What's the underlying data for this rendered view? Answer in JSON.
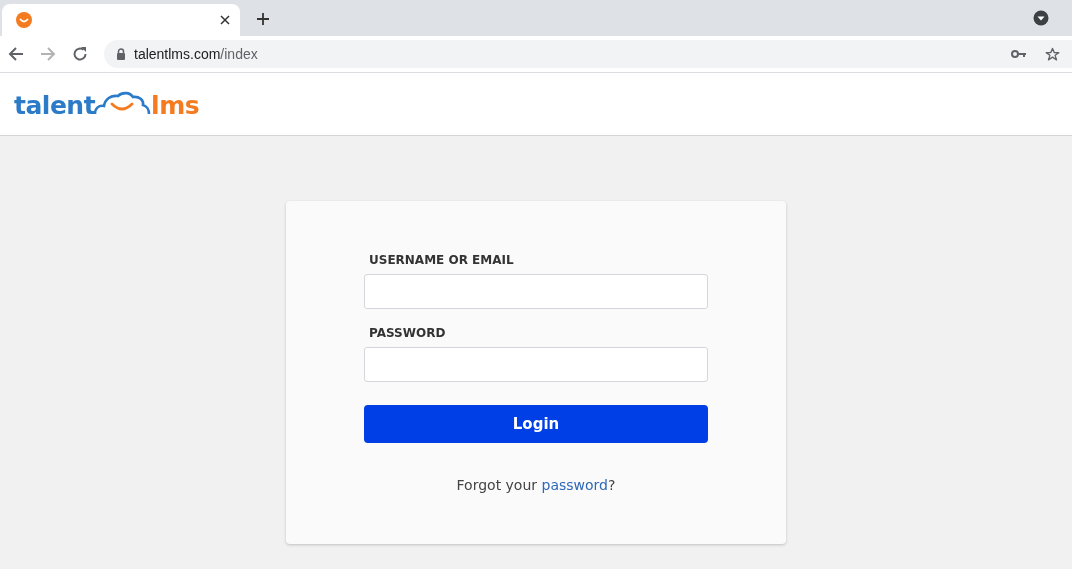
{
  "browser": {
    "tabs": [
      {
        "selected": true
      }
    ],
    "nav": [
      {
        "kind": "back",
        "disabled": false
      },
      {
        "kind": "forward",
        "disabled": true
      },
      {
        "kind": "reload",
        "disabled": false
      }
    ],
    "url": {
      "host": "talentlms.com",
      "path": "/index"
    }
  },
  "logo": {
    "left": "talent",
    "right": "lms"
  },
  "form": {
    "fields": [
      {
        "label": "USERNAME OR EMAIL"
      },
      {
        "label": "PASSWORD"
      }
    ],
    "submit": "Login",
    "forgot": {
      "before": "Forgot your ",
      "link": "password",
      "after": "?"
    }
  }
}
